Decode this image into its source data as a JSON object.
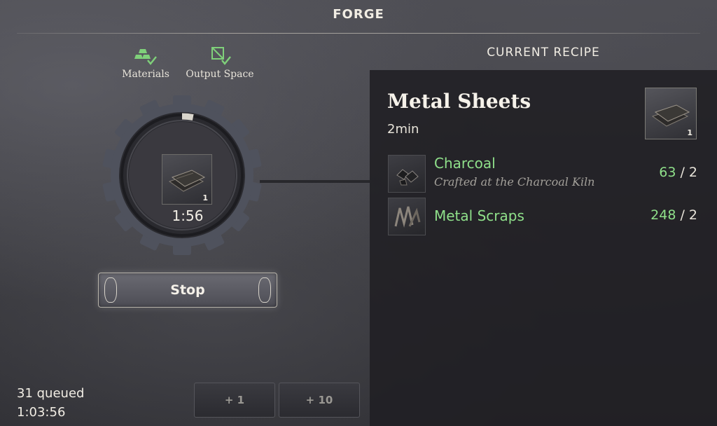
{
  "window": {
    "title": "FORGE"
  },
  "status": {
    "materials": {
      "label": "Materials",
      "icon": "gold-bars-check-icon",
      "ok": true
    },
    "output_space": {
      "label": "Output Space",
      "icon": "crate-check-icon",
      "ok": true
    }
  },
  "crafting": {
    "item_count": "1",
    "timer": "1:56",
    "progress_fraction": 0.03,
    "stop_label": "Stop"
  },
  "queue": {
    "queued_text": "31 queued",
    "total_time": "1:03:56",
    "add_one_label": "+ 1",
    "add_ten_label": "+ 10"
  },
  "recipe": {
    "header": "CURRENT RECIPE",
    "name": "Metal Sheets",
    "time": "2min",
    "output_count": "1",
    "ingredients": [
      {
        "name": "Charcoal",
        "subtitle": "Crafted at the Charcoal Kiln",
        "have": "63",
        "need": "/ 2"
      },
      {
        "name": "Metal Scraps",
        "subtitle": "",
        "have": "248",
        "need": "/ 2"
      }
    ]
  },
  "colors": {
    "accent_green": "#8fe08a",
    "panel": "#201f23",
    "text": "#e8e4da"
  }
}
